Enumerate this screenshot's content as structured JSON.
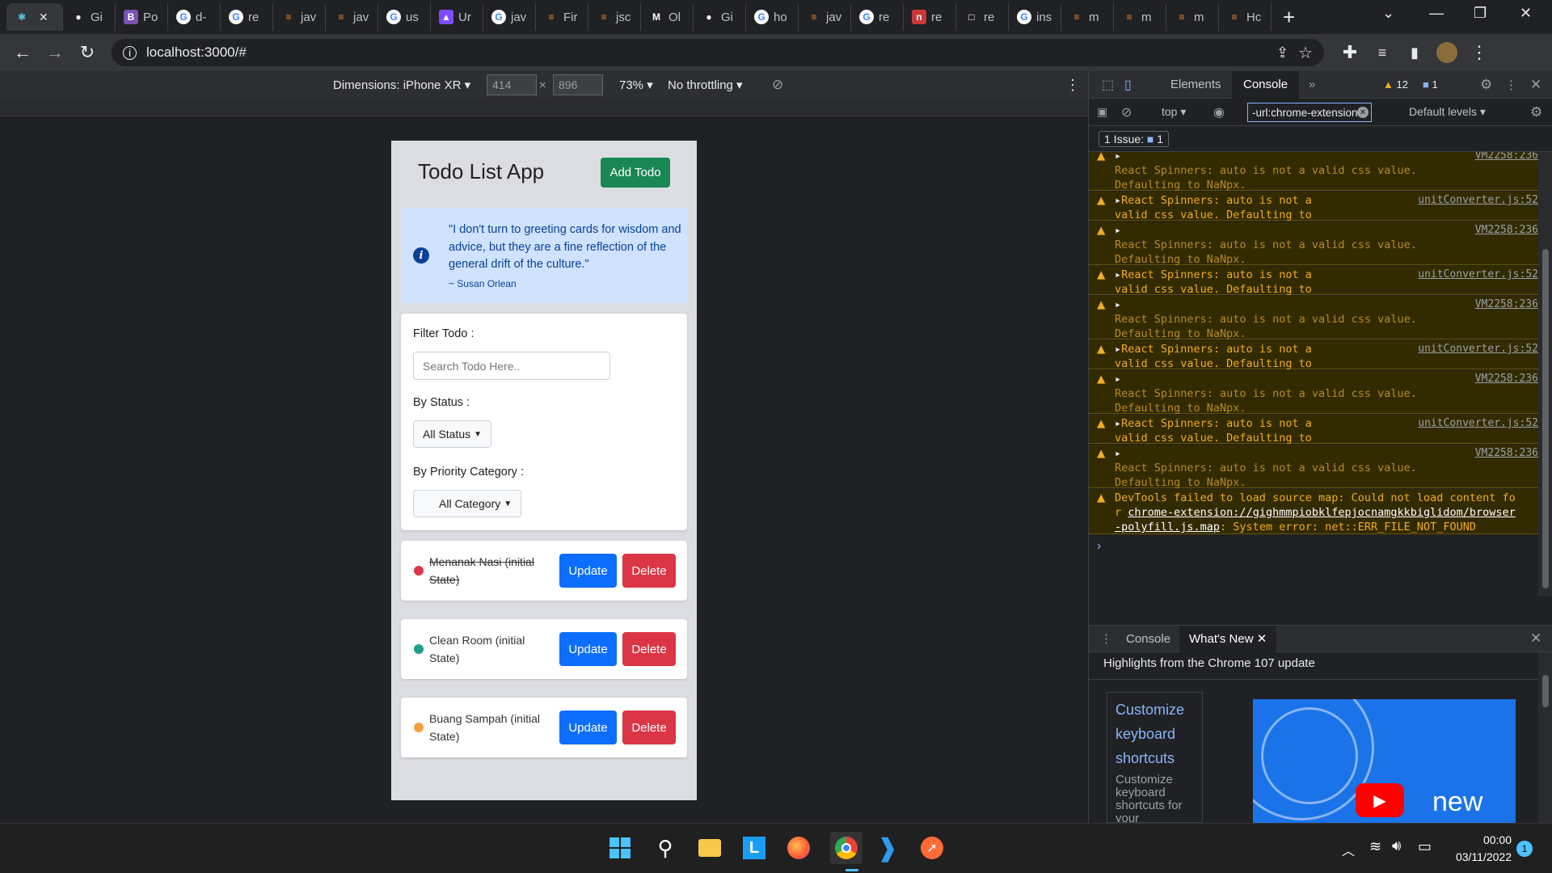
{
  "browser": {
    "tabs": [
      {
        "label": "",
        "icon": "react-icon"
      },
      {
        "label": "Gi",
        "icon": "github-icon"
      },
      {
        "label": "Po",
        "icon": "bootstrap-icon"
      },
      {
        "label": "d-",
        "icon": "google-icon"
      },
      {
        "label": "re",
        "icon": "google-icon"
      },
      {
        "label": "jav",
        "icon": "stackoverflow-icon"
      },
      {
        "label": "jav",
        "icon": "stackoverflow-icon"
      },
      {
        "label": "us",
        "icon": "google-icon"
      },
      {
        "label": "Ur",
        "icon": "ur-icon"
      },
      {
        "label": "jav",
        "icon": "google-icon"
      },
      {
        "label": "Fir",
        "icon": "stackoverflow-icon"
      },
      {
        "label": "jsc",
        "icon": "stackoverflow-icon"
      },
      {
        "label": "Ol",
        "icon": "medium-icon"
      },
      {
        "label": "Gi",
        "icon": "github-icon"
      },
      {
        "label": "ho",
        "icon": "google-icon"
      },
      {
        "label": "jav",
        "icon": "stackoverflow-icon"
      },
      {
        "label": "re",
        "icon": "google-icon"
      },
      {
        "label": "re",
        "icon": "npm-icon"
      },
      {
        "label": "re",
        "icon": "blank-page-icon"
      },
      {
        "label": "ins",
        "icon": "google-icon"
      },
      {
        "label": "m",
        "icon": "stackoverflow-icon"
      },
      {
        "label": "m",
        "icon": "stackoverflow-icon"
      },
      {
        "label": "m",
        "icon": "stackoverflow-icon"
      },
      {
        "label": "Hc",
        "icon": "stackoverflow-icon"
      }
    ],
    "url": "localhost:3000/#"
  },
  "device_toolbar": {
    "dimensions": "Dimensions: iPhone XR",
    "width": "414",
    "height": "896",
    "zoom": "73%",
    "throttling": "No throttling"
  },
  "app": {
    "title": "Todo List App",
    "add_button": "Add Todo",
    "quote": "\"I don't turn to greeting cards for wisdom and advice, but they are a fine reflection of the general drift of the culture.\"",
    "quote_author": "~ Susan Orlean",
    "filter_label": "Filter Todo :",
    "search_placeholder": "Search Todo Here..",
    "status_label": "By Status :",
    "status_value": "All Status",
    "category_label": "By Priority Category :",
    "category_value": "All Category",
    "todos": [
      {
        "text": "Menanak Nasi (initial State)",
        "color": "#dc3545",
        "done": true
      },
      {
        "text": "Clean Room (initial State)",
        "color": "#20a08a",
        "done": false
      },
      {
        "text": "Buang Sampah (initial State)",
        "color": "#f0a040",
        "done": false
      }
    ],
    "update_label": "Update",
    "delete_label": "Delete"
  },
  "devtools": {
    "tabs": [
      "Elements",
      "Console"
    ],
    "warn_count": "12",
    "msg_count": "1",
    "context": "top",
    "filter": "-url:chrome-extension://",
    "levels": "Default levels",
    "issues": "1 Issue:",
    "issues_count": "1",
    "logs": [
      {
        "src": "VM2258:236",
        "msg": "React Spinners: auto is not a valid css value. Defaulting to NaNpx.",
        "dim": true
      },
      {
        "src": "unitConverter.js:52",
        "msg": "React Spinners: auto is not a valid css value. Defaulting to NaNpx.",
        "dim": false
      },
      {
        "src": "VM2258:236",
        "msg": "React Spinners: auto is not a valid css value. Defaulting to NaNpx.",
        "dim": true
      },
      {
        "src": "unitConverter.js:52",
        "msg": "React Spinners: auto is not a valid css value. Defaulting to NaNpx.",
        "dim": false
      },
      {
        "src": "VM2258:236",
        "msg": "React Spinners: auto is not a valid css value. Defaulting to NaNpx.",
        "dim": true
      },
      {
        "src": "unitConverter.js:52",
        "msg": "React Spinners: auto is not a valid css value. Defaulting to NaNpx.",
        "dim": false
      },
      {
        "src": "VM2258:236",
        "msg": "React Spinners: auto is not a valid css value. Defaulting to NaNpx.",
        "dim": true
      },
      {
        "src": "unitConverter.js:52",
        "msg": "React Spinners: auto is not a valid css value. Defaulting to NaNpx.",
        "dim": false
      },
      {
        "src": "VM2258:236",
        "msg": "React Spinners: auto is not a valid css value. Defaulting to NaNpx.",
        "dim": true
      }
    ],
    "sourcemap_pre": "DevTools failed to load source map: Could not load content for ",
    "sourcemap_link": "chrome-extension://gighmmpiobklfepjocnamgkkbiglidom/browser-polyfill.js.map",
    "sourcemap_post": ": System error: net::ERR_FILE_NOT_FOUND",
    "drawer_tabs": [
      "Console",
      "What's New"
    ],
    "whats_new_title": "Highlights from the Chrome 107 update",
    "shortcut_link": "Customize keyboard shortcuts",
    "shortcut_desc": "Customize keyboard shortcuts for your",
    "video_text": "new"
  },
  "taskbar": {
    "time": "00:00",
    "date": "03/11/2022",
    "notif": "1"
  }
}
